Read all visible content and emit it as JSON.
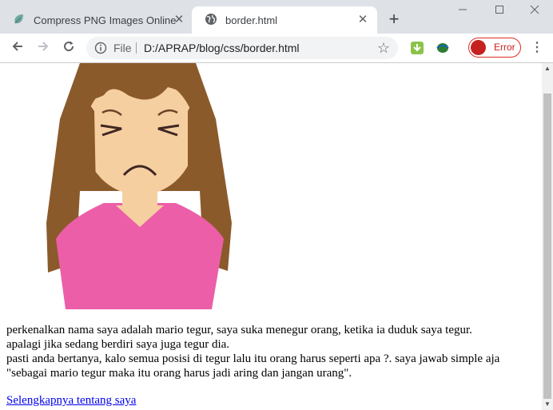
{
  "tabs": [
    {
      "label": "Compress PNG Images Online",
      "icon": "leaf-icon",
      "active": false
    },
    {
      "label": "border.html",
      "icon": "globe-icon",
      "active": true
    }
  ],
  "toolbar": {
    "scheme_label": "File",
    "url": "D:/APRAP/blog/css/border.html",
    "profile_label": "Error"
  },
  "colors": {
    "tabstrip": "#dee1e6",
    "hair": "#8b5a2b",
    "shirt": "#ec5fa8",
    "skin": "#f6cfa1",
    "error": "#c5221f"
  },
  "page": {
    "line1": "perkenalkan nama saya adalah mario tegur, saya suka menegur orang, ketika ia duduk saya tegur.",
    "line2": "apalagi jika sedang berdiri saya juga tegur dia.",
    "line3": "pasti anda bertanya, kalo semua posisi di tegur lalu itu orang harus seperti apa ?. saya jawab simple aja",
    "line4": "\"sebagai mario tegur maka itu orang harus jadi aring dan jangan urang\".",
    "link": "Selengkapnya tentang saya"
  }
}
